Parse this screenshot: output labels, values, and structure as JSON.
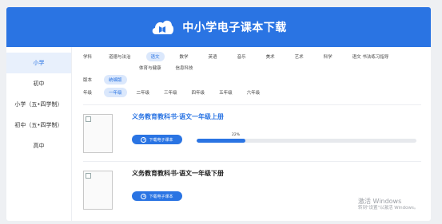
{
  "header": {
    "title": "中小学电子课本下载"
  },
  "sidebar": {
    "items": [
      {
        "label": "小学",
        "active": true
      },
      {
        "label": "初中",
        "active": false
      },
      {
        "label": "小学（五•四学制）",
        "active": false
      },
      {
        "label": "初中（五•四学制）",
        "active": false
      },
      {
        "label": "高中",
        "active": false
      }
    ]
  },
  "filters": {
    "subject_label": "学科",
    "subjects": [
      "道德与法治",
      "语文",
      "数学",
      "英语",
      "音乐",
      "美术",
      "艺术",
      "科学",
      "语文 书法练习指导"
    ],
    "subjects_row2": [
      "体育与健康",
      "信息科技"
    ],
    "active_subject": "语文",
    "edition_label": "版本",
    "editions": [
      "统编版"
    ],
    "active_edition": "统编版",
    "grade_label": "年级",
    "grades": [
      "一年级",
      "二年级",
      "三年级",
      "四年级",
      "五年级",
      "六年级"
    ],
    "active_grade": "一年级"
  },
  "books": [
    {
      "title": "义务教育教科书·语文一年级上册",
      "download_label": "下载电子课本",
      "progress_text": "22%",
      "progress": 0.22
    },
    {
      "title": "义务教育教科书·语文一年级下册",
      "download_label": "下载电子课本"
    }
  ],
  "watermark": {
    "title": "激活 Windows",
    "subtitle": "转到\"设置\"以激活 Windows。"
  },
  "colors": {
    "primary": "#2a74e3",
    "active_bg": "#dbe8fc"
  }
}
